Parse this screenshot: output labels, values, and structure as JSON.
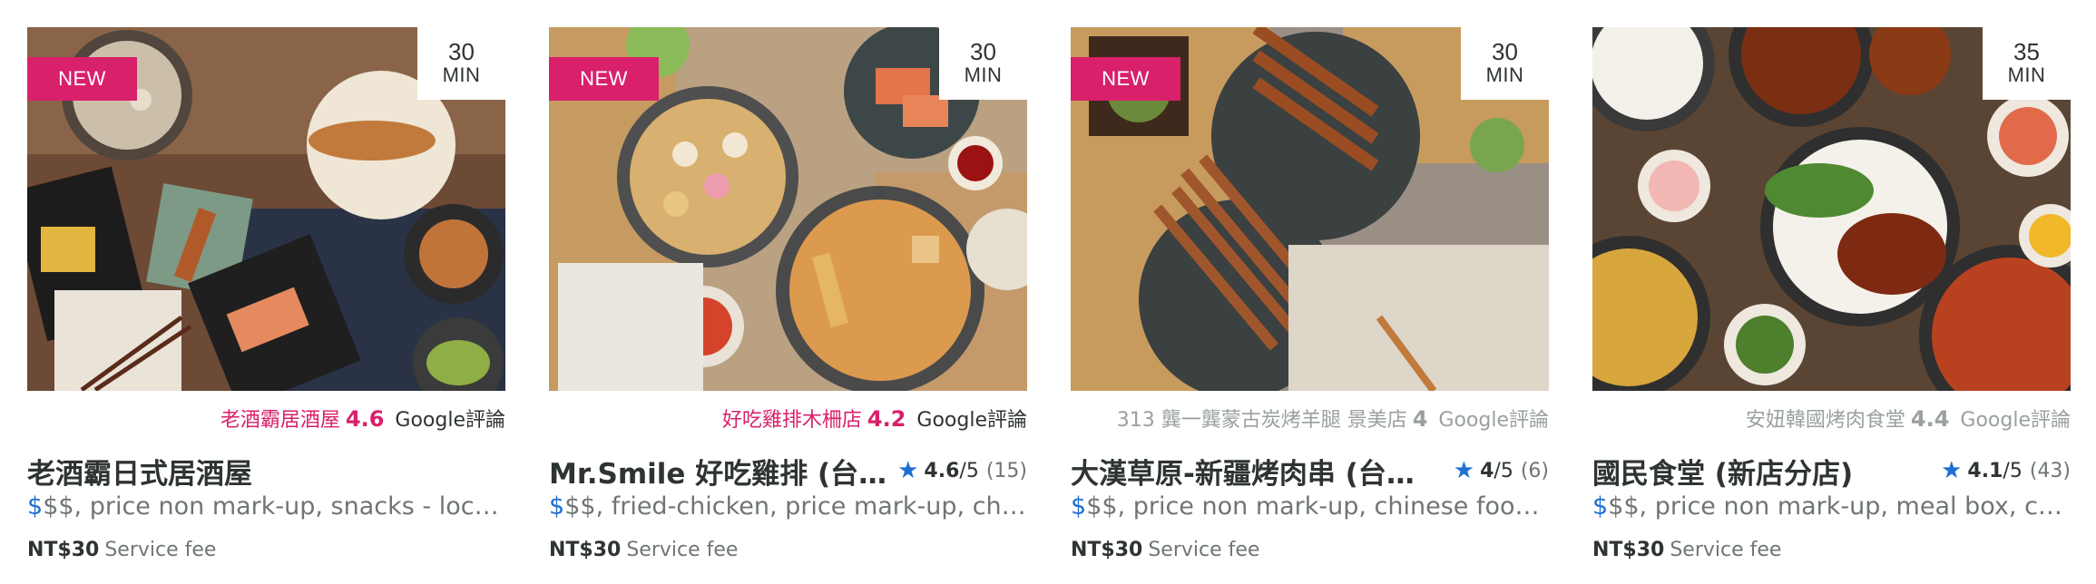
{
  "cards": [
    {
      "new_badge": "NEW",
      "delivery_time": "30",
      "delivery_unit": "MIN",
      "google_name": "老酒霸居酒屋",
      "google_rating": "4.6",
      "google_label": "Google評論",
      "title": "老酒霸日式居酒屋",
      "rating_score": "",
      "rating_outof": "",
      "rating_count": "",
      "price_active": "$",
      "price_rest": "$$, price non mark-up, snacks - local…",
      "fee_amount": "NT$30",
      "fee_label": "Service fee",
      "google_style": "pink"
    },
    {
      "new_badge": "NEW",
      "delivery_time": "30",
      "delivery_unit": "MIN",
      "google_name": "好吃雞排木柵店",
      "google_rating": "4.2",
      "google_label": "Google評論",
      "title": "Mr.Smile 好吃雞排 (台…",
      "rating_score": "4.6",
      "rating_outof": "/5",
      "rating_count": "(15)",
      "price_active": "$",
      "price_rest": "$$, fried-chicken, price mark-up, chi…",
      "fee_amount": "NT$30",
      "fee_label": "Service fee",
      "google_style": "pink"
    },
    {
      "new_badge": "NEW",
      "delivery_time": "30",
      "delivery_unit": "MIN",
      "google_name": "313 龔一龔蒙古炭烤羊腿 景美店",
      "google_rating": "4",
      "google_label": "Google評論",
      "title": "大漢草原-新疆烤肉串 (台…",
      "rating_score": "4",
      "rating_outof": "/5",
      "rating_count": "(6)",
      "price_active": "$",
      "price_rest": "$$, price non mark-up, chinese food,…",
      "fee_amount": "NT$30",
      "fee_label": "Service fee",
      "google_style": "grey"
    },
    {
      "new_badge": "",
      "delivery_time": "35",
      "delivery_unit": "MIN",
      "google_name": "安妞韓國烤肉食堂",
      "google_rating": "4.4",
      "google_label": "Google評論",
      "title": "國民食堂 (新店分店)",
      "rating_score": "4.1",
      "rating_outof": "/5",
      "rating_count": "(43)",
      "price_active": "$",
      "price_rest": "$$, price non mark-up, meal box, chi…",
      "fee_amount": "NT$30",
      "fee_label": "Service fee",
      "google_style": "grey"
    }
  ],
  "colors": {
    "brand_pink": "#d9206b",
    "star_blue": "#1f6fd1",
    "text_dark": "#2e3333",
    "text_muted": "#6f7575",
    "text_faded": "#9aa0a0"
  },
  "icons": {
    "rating": "star-icon"
  }
}
